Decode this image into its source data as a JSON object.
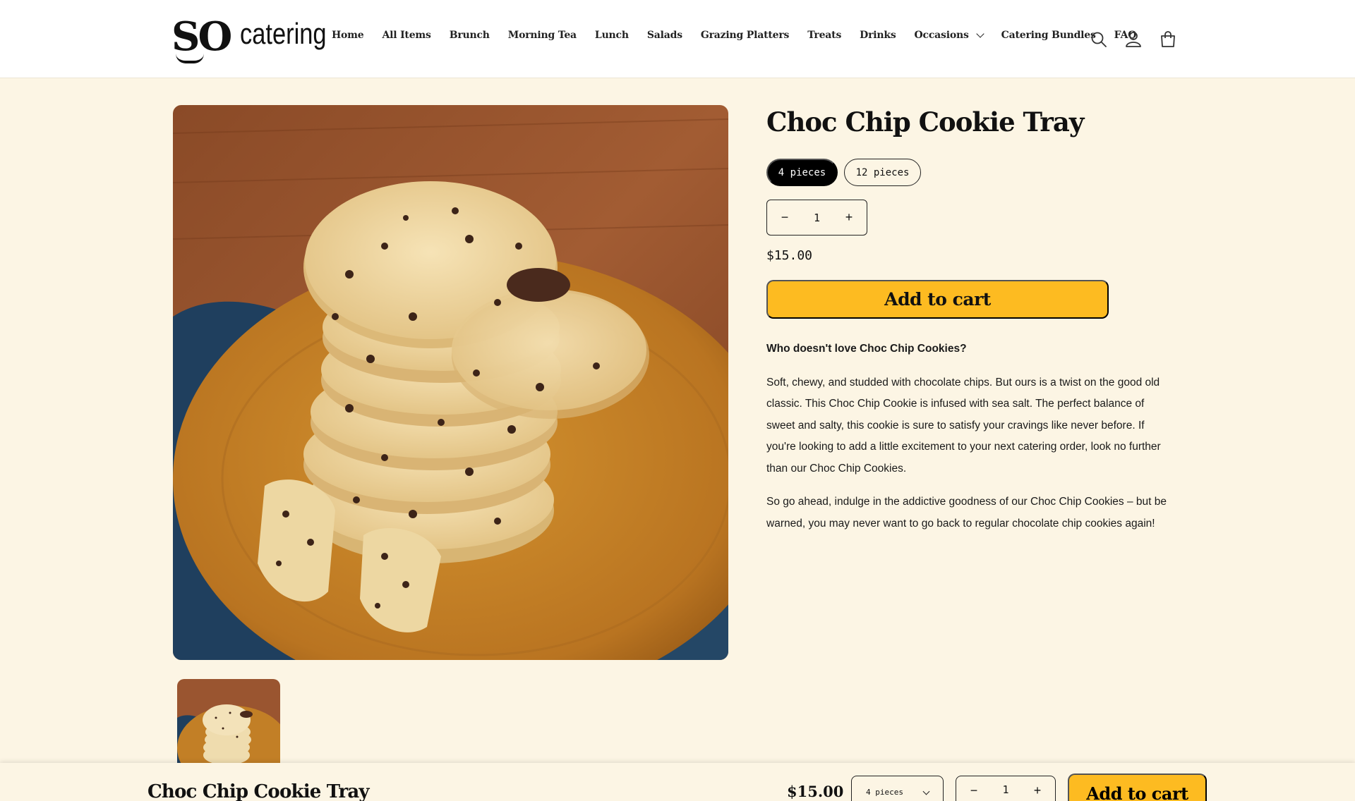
{
  "header": {
    "logo_so": "SO",
    "logo_word": "catering",
    "nav": [
      {
        "label": "Home"
      },
      {
        "label": "All Items"
      },
      {
        "label": "Brunch"
      },
      {
        "label": "Morning Tea"
      },
      {
        "label": "Lunch"
      },
      {
        "label": "Salads"
      },
      {
        "label": "Grazing Platters"
      },
      {
        "label": "Treats"
      },
      {
        "label": "Drinks"
      },
      {
        "label": "Occasions",
        "has_dropdown": true
      },
      {
        "label": "Catering Bundles"
      },
      {
        "label": "FAQ"
      }
    ],
    "icons": [
      "search-icon",
      "account-icon",
      "cart-icon"
    ]
  },
  "product": {
    "title": "Choc Chip Cookie Tray",
    "variants": [
      {
        "label": "4 pieces",
        "selected": true
      },
      {
        "label": "12 pieces",
        "selected": false
      }
    ],
    "quantity": "1",
    "qty_minus": "−",
    "qty_plus": "+",
    "price": "$15.00",
    "add_to_cart": "Add to cart",
    "description": {
      "lead": "Who doesn't love Choc Chip Cookies?",
      "p1": "Soft, chewy, and studded with chocolate chips. But ours is a twist on the good old classic. This Choc Chip Cookie is infused with sea salt. The perfect balance of sweet and salty, this cookie is sure to satisfy your cravings like never before. If you're looking to add a little excitement to your next catering order, look no further than our Choc Chip Cookies.",
      "p2": "So go ahead, indulge in the addictive goodness of our Choc Chip Cookies – but be warned, you may never want to go back to regular chocolate chip cookies again!"
    }
  },
  "sticky_bar": {
    "title": "Choc Chip Cookie Tray",
    "price": "$15.00",
    "variant": "4 pieces",
    "quantity": "1",
    "qty_minus": "−",
    "qty_plus": "+",
    "add_to_cart": "Add to cart"
  },
  "colors": {
    "background": "#fcf5e4",
    "accent": "#fdbb21",
    "selected_pill": "#000000"
  }
}
